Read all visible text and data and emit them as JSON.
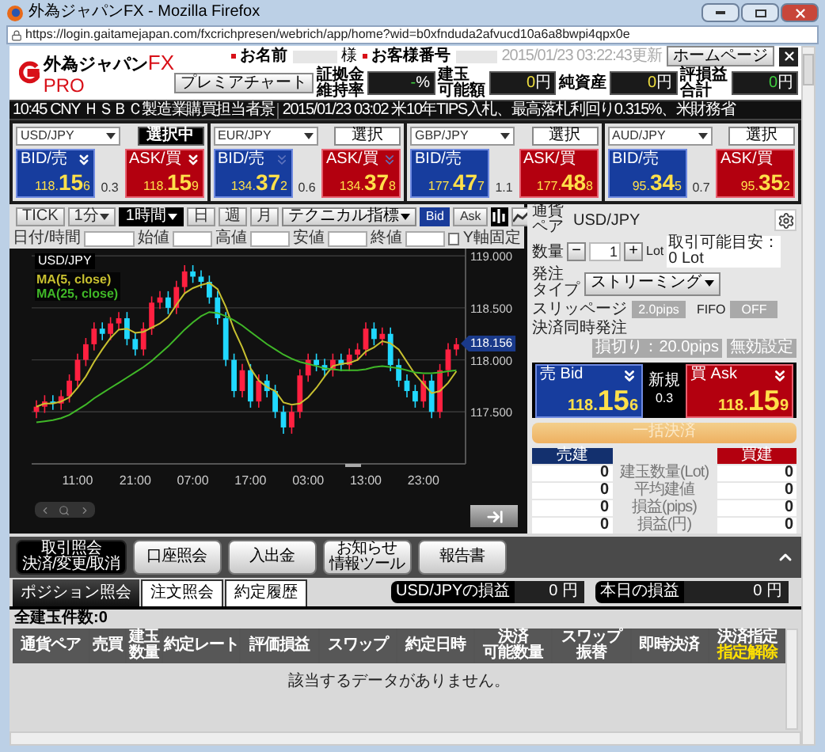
{
  "browser": {
    "title": "外為ジャパンFX - Mozilla Firefox",
    "url": "https://login.gaitamejapan.com/fxcrichpresen/webrich/app/home?wid=b0xfnduda2afvucd10a6a8bwpi4qpx0e"
  },
  "header": {
    "logo_main": "外為ジャパン",
    "logo_fx": "FX",
    "logo_sub": "PRO",
    "name_label": "お名前",
    "honorific": "様",
    "customer_label": "お客様番号",
    "updated": "2015/01/23 03:22:43更新",
    "homepage_button": "ホームページ",
    "premium_button": "プレミアチャート",
    "accounts": [
      {
        "label": [
          "証拠金",
          "維持率"
        ],
        "value": "-",
        "unit": "%",
        "color": "#40d040"
      },
      {
        "label": [
          "建玉",
          "可能額"
        ],
        "value": "0",
        "unit": "円",
        "color": "#f0e040"
      },
      {
        "label": [
          "純資産"
        ],
        "value": "0",
        "unit": "円",
        "color": "#f0e040"
      },
      {
        "label": [
          "評損益",
          "合計"
        ],
        "value": "0",
        "unit": "円",
        "color": "#40d040"
      }
    ]
  },
  "ticker": [
    {
      "text": "10:45 CNY ＨＳＢＣ製造業購買担当者景"
    },
    {
      "text": "2015/01/23 03:02 米10年TIPS入札、最高落札利回り0.315%、米財務省"
    }
  ],
  "pairs": [
    {
      "symbol": "USD/JPY",
      "button": "選択中",
      "selected": true,
      "arrow": true,
      "arrow_faded": false,
      "bid_label": "BID/売",
      "bid": [
        "118.",
        "15",
        "6"
      ],
      "spread": "0.3",
      "ask_label": "ASK/買",
      "ask": [
        "118.",
        "15",
        "9"
      ]
    },
    {
      "symbol": "EUR/JPY",
      "button": "選択",
      "selected": false,
      "arrow": true,
      "arrow_faded": true,
      "bid_label": "BID/売",
      "bid": [
        "134.",
        "37",
        "2"
      ],
      "spread": "0.6",
      "ask_label": "ASK/買",
      "ask": [
        "134.",
        "37",
        "8"
      ]
    },
    {
      "symbol": "GBP/JPY",
      "button": "選択",
      "selected": false,
      "arrow": false,
      "bid_label": "BID/売",
      "bid": [
        "177.",
        "47",
        "7"
      ],
      "spread": "1.1",
      "ask_label": "ASK/買",
      "ask": [
        "177.",
        "48",
        "8"
      ]
    },
    {
      "symbol": "AUD/JPY",
      "button": "選択",
      "selected": false,
      "arrow": false,
      "bid_label": "BID/売",
      "bid": [
        "95.",
        "34",
        "5"
      ],
      "spread": "0.7",
      "ask_label": "ASK/買",
      "ask": [
        "95.",
        "35",
        "2"
      ]
    }
  ],
  "chart_toolbar": {
    "periods": [
      {
        "label": "TICK",
        "dropdown": false,
        "selected": false
      },
      {
        "label": "1分",
        "dropdown": true,
        "selected": false
      },
      {
        "label": "1時間",
        "dropdown": true,
        "selected": true
      },
      {
        "label": "日",
        "dropdown": false,
        "selected": false
      },
      {
        "label": "週",
        "dropdown": false,
        "selected": false
      },
      {
        "label": "月",
        "dropdown": false,
        "selected": false
      }
    ],
    "indicator": "テクニカル指標",
    "sides": [
      {
        "label": "Bid",
        "selected": true
      },
      {
        "label": "Ask",
        "selected": false
      }
    ],
    "chart_types": [
      {
        "kind": "candle",
        "selected": true
      },
      {
        "kind": "line",
        "selected": false
      }
    ]
  },
  "ohlc": {
    "fields": [
      "日付/時間",
      "始値",
      "高値",
      "安値",
      "終値"
    ],
    "y_lock": {
      "label": "Y軸固定",
      "checked": false
    }
  },
  "chart": {
    "symbol": "USD/JPY",
    "last_price": "118.156",
    "chart_data": {
      "type": "candlestick",
      "categories": [
        null,
        null,
        null,
        null,
        null,
        "11:00",
        null,
        null,
        null,
        null,
        null,
        null,
        "21:00",
        null,
        null,
        null,
        null,
        null,
        null,
        "07:00",
        null,
        null,
        null,
        null,
        null,
        null,
        "17:00",
        null,
        null,
        null,
        null,
        null,
        null,
        "03:00",
        null,
        null,
        null,
        null,
        null,
        null,
        "13:00",
        null,
        null,
        null,
        null,
        null,
        null,
        "23:00",
        null,
        null,
        null,
        null
      ],
      "ylim": [
        117.0,
        119.07
      ],
      "grid": true,
      "ohlc": [
        [
          117.5,
          117.61,
          117.44,
          117.55
        ],
        [
          117.55,
          117.66,
          117.49,
          117.6
        ],
        [
          117.6,
          117.66,
          117.52,
          117.58
        ],
        [
          117.58,
          117.71,
          117.52,
          117.65
        ],
        [
          117.65,
          117.86,
          117.59,
          117.8
        ],
        [
          117.8,
          118.06,
          117.74,
          118.0
        ],
        [
          118.0,
          118.21,
          117.94,
          118.15
        ],
        [
          118.15,
          118.36,
          118.09,
          118.3
        ],
        [
          118.3,
          118.36,
          118.19,
          118.25
        ],
        [
          118.25,
          118.41,
          118.19,
          118.35
        ],
        [
          118.35,
          118.46,
          118.29,
          118.4
        ],
        [
          118.4,
          118.46,
          118.14,
          118.2
        ],
        [
          118.2,
          118.26,
          118.04,
          118.1
        ],
        [
          118.1,
          118.36,
          118.04,
          118.3
        ],
        [
          118.3,
          118.61,
          118.24,
          118.55
        ],
        [
          118.55,
          118.66,
          118.49,
          118.6
        ],
        [
          118.6,
          118.66,
          118.44,
          118.5
        ],
        [
          118.5,
          118.76,
          118.44,
          118.7
        ],
        [
          118.7,
          118.91,
          118.64,
          118.85
        ],
        [
          118.85,
          118.91,
          118.74,
          118.8
        ],
        [
          118.8,
          118.86,
          118.69,
          118.75
        ],
        [
          118.75,
          118.81,
          118.54,
          118.6
        ],
        [
          118.6,
          118.66,
          118.34,
          118.4
        ],
        [
          118.4,
          118.46,
          117.94,
          118.0
        ],
        [
          118.0,
          118.06,
          117.64,
          117.7
        ],
        [
          117.7,
          117.96,
          117.64,
          117.9
        ],
        [
          117.9,
          117.96,
          117.54,
          117.6
        ],
        [
          117.6,
          117.86,
          117.54,
          117.8
        ],
        [
          117.8,
          117.86,
          117.64,
          117.7
        ],
        [
          117.7,
          117.76,
          117.44,
          117.5
        ],
        [
          117.5,
          117.56,
          117.29,
          117.35
        ],
        [
          117.35,
          117.56,
          117.29,
          117.5
        ],
        [
          117.5,
          117.91,
          117.44,
          117.85
        ],
        [
          117.85,
          118.06,
          117.79,
          118.0
        ],
        [
          118.0,
          118.06,
          117.89,
          117.95
        ],
        [
          117.95,
          118.01,
          117.84,
          117.9
        ],
        [
          117.9,
          118.06,
          117.84,
          118.0
        ],
        [
          118.0,
          118.06,
          117.89,
          117.95
        ],
        [
          117.95,
          118.11,
          117.89,
          118.05
        ],
        [
          118.05,
          118.16,
          117.99,
          118.1
        ],
        [
          118.1,
          118.36,
          118.04,
          118.3
        ],
        [
          118.3,
          118.36,
          118.14,
          118.2
        ],
        [
          118.2,
          118.31,
          118.14,
          118.25
        ],
        [
          118.25,
          118.31,
          117.89,
          117.95
        ],
        [
          117.95,
          118.01,
          117.74,
          117.8
        ],
        [
          117.8,
          117.86,
          117.64,
          117.7
        ],
        [
          117.7,
          117.76,
          117.54,
          117.6
        ],
        [
          117.6,
          117.86,
          117.54,
          117.8
        ],
        [
          117.8,
          117.86,
          117.44,
          117.5
        ],
        [
          117.5,
          117.96,
          117.44,
          117.9
        ],
        [
          117.9,
          118.16,
          117.84,
          118.1
        ],
        [
          118.1,
          118.21,
          118.04,
          118.15
        ]
      ],
      "yticks": [
        {
          "value": 119,
          "label": "119.000"
        },
        {
          "value": 118.5,
          "label": "118.500"
        },
        {
          "value": 118,
          "label": "118.000"
        },
        {
          "value": 117.5,
          "label": "117.500"
        }
      ],
      "series": [
        {
          "type": "line",
          "name": "MA(5, close)",
          "color": "#c8c030",
          "values": [
            117.55,
            117.58,
            117.58,
            117.6,
            117.64,
            117.73,
            117.84,
            117.98,
            118.1,
            118.21,
            118.29,
            118.3,
            118.26,
            118.27,
            118.31,
            118.35,
            118.41,
            118.53,
            118.64,
            118.69,
            118.72,
            118.74,
            118.68,
            118.51,
            118.29,
            118.12,
            117.92,
            117.8,
            117.74,
            117.7,
            117.59,
            117.57,
            117.58,
            117.64,
            117.73,
            117.84,
            117.94,
            117.96,
            117.97,
            118.0,
            118.08,
            118.12,
            118.18,
            118.16,
            118.1,
            117.98,
            117.86,
            117.77,
            117.68,
            117.7,
            117.78,
            117.89
          ]
        },
        {
          "type": "line",
          "name": "MA(25, close)",
          "color": "#40b828",
          "values": [
            117.4,
            117.41,
            117.42,
            117.44,
            117.47,
            117.52,
            117.57,
            117.63,
            117.68,
            117.73,
            117.78,
            117.83,
            117.88,
            117.93,
            117.99,
            118.06,
            118.13,
            118.21,
            118.29,
            118.36,
            118.42,
            118.46,
            118.45,
            118.42,
            118.38,
            118.33,
            118.27,
            118.21,
            118.15,
            118.1,
            118.05,
            118.01,
            117.98,
            117.96,
            117.94,
            117.92,
            117.91,
            117.9,
            117.9,
            117.9,
            117.91,
            117.93,
            117.94,
            117.93,
            117.92,
            117.9,
            117.88,
            117.87,
            117.87,
            117.88,
            117.89,
            117.9
          ]
        }
      ]
    }
  },
  "order": {
    "pair_label": [
      "通貨",
      "ペア"
    ],
    "pair": "USD/JPY",
    "qty_label": "数量",
    "minus": "−",
    "qty": "1",
    "plus": "+",
    "unit": "Lot",
    "available": "取引可能目安：0 Lot",
    "type_label": [
      "発注",
      "タイプ"
    ],
    "type": "ストリーミング",
    "slippage_label": "スリッページ",
    "slippage": "2.0pips",
    "fifo_label": "FIFO",
    "fifo": "OFF",
    "settle_label": "決済同時発注",
    "settle_options": [
      {
        "label": "損切り：20.0pips",
        "disabled": true
      },
      {
        "label": "無効設定",
        "disabled": true
      }
    ],
    "bid": {
      "label": "売 Bid",
      "price": [
        "118.",
        "15",
        "6"
      ]
    },
    "new_label": "新規",
    "spread": "0.3",
    "ask": {
      "label": "買 Ask",
      "price": [
        "118.",
        "15",
        "9"
      ]
    },
    "bulk_button": {
      "label": "一括決済",
      "disabled": true
    },
    "sell_header": "売建",
    "buy_header": "買建",
    "positions": [
      {
        "label": "建玉数量(Lot)",
        "sell": "0",
        "buy": "0"
      },
      {
        "label": "平均建値",
        "sell": "0",
        "buy": "0"
      },
      {
        "label": "損益(pips)",
        "sell": "0",
        "buy": "0"
      },
      {
        "label": "損益(円)",
        "sell": "0",
        "buy": "0"
      }
    ]
  },
  "nav": [
    {
      "lines": [
        "取引照会",
        "決済/変更/取消"
      ],
      "selected": true
    },
    {
      "lines": [
        "口座照会"
      ],
      "selected": false
    },
    {
      "lines": [
        "入出金"
      ],
      "selected": false
    },
    {
      "lines": [
        "お知らせ",
        "情報ツール"
      ],
      "selected": false
    },
    {
      "lines": [
        "報告書"
      ],
      "selected": false
    }
  ],
  "tabs": [
    {
      "label": "ポジション照会",
      "selected": true
    },
    {
      "label": "注文照会",
      "selected": false
    },
    {
      "label": "約定履歴",
      "selected": false
    }
  ],
  "pl": [
    {
      "label": "USD/JPYの損益",
      "value": "0 円"
    },
    {
      "label": "本日の損益",
      "value": "0 円"
    }
  ],
  "count": "全建玉件数:0",
  "table": {
    "columns": [
      {
        "lines": [
          "通貨ペア"
        ]
      },
      {
        "lines": [
          "売買"
        ]
      },
      {
        "lines": [
          "建玉",
          "数量"
        ]
      },
      {
        "lines": [
          "約定レート"
        ]
      },
      {
        "lines": [
          "評価損益"
        ]
      },
      {
        "lines": [
          "スワップ"
        ]
      },
      {
        "lines": [
          "約定日時"
        ]
      },
      {
        "lines": [
          "決済",
          "可能数量"
        ]
      },
      {
        "lines": [
          "スワップ",
          "振替"
        ]
      },
      {
        "lines": [
          "即時決済"
        ]
      },
      {
        "lines": [
          "決済指定"
        ],
        "sub": "指定解除"
      }
    ],
    "empty": "該当するデータがありません。"
  }
}
